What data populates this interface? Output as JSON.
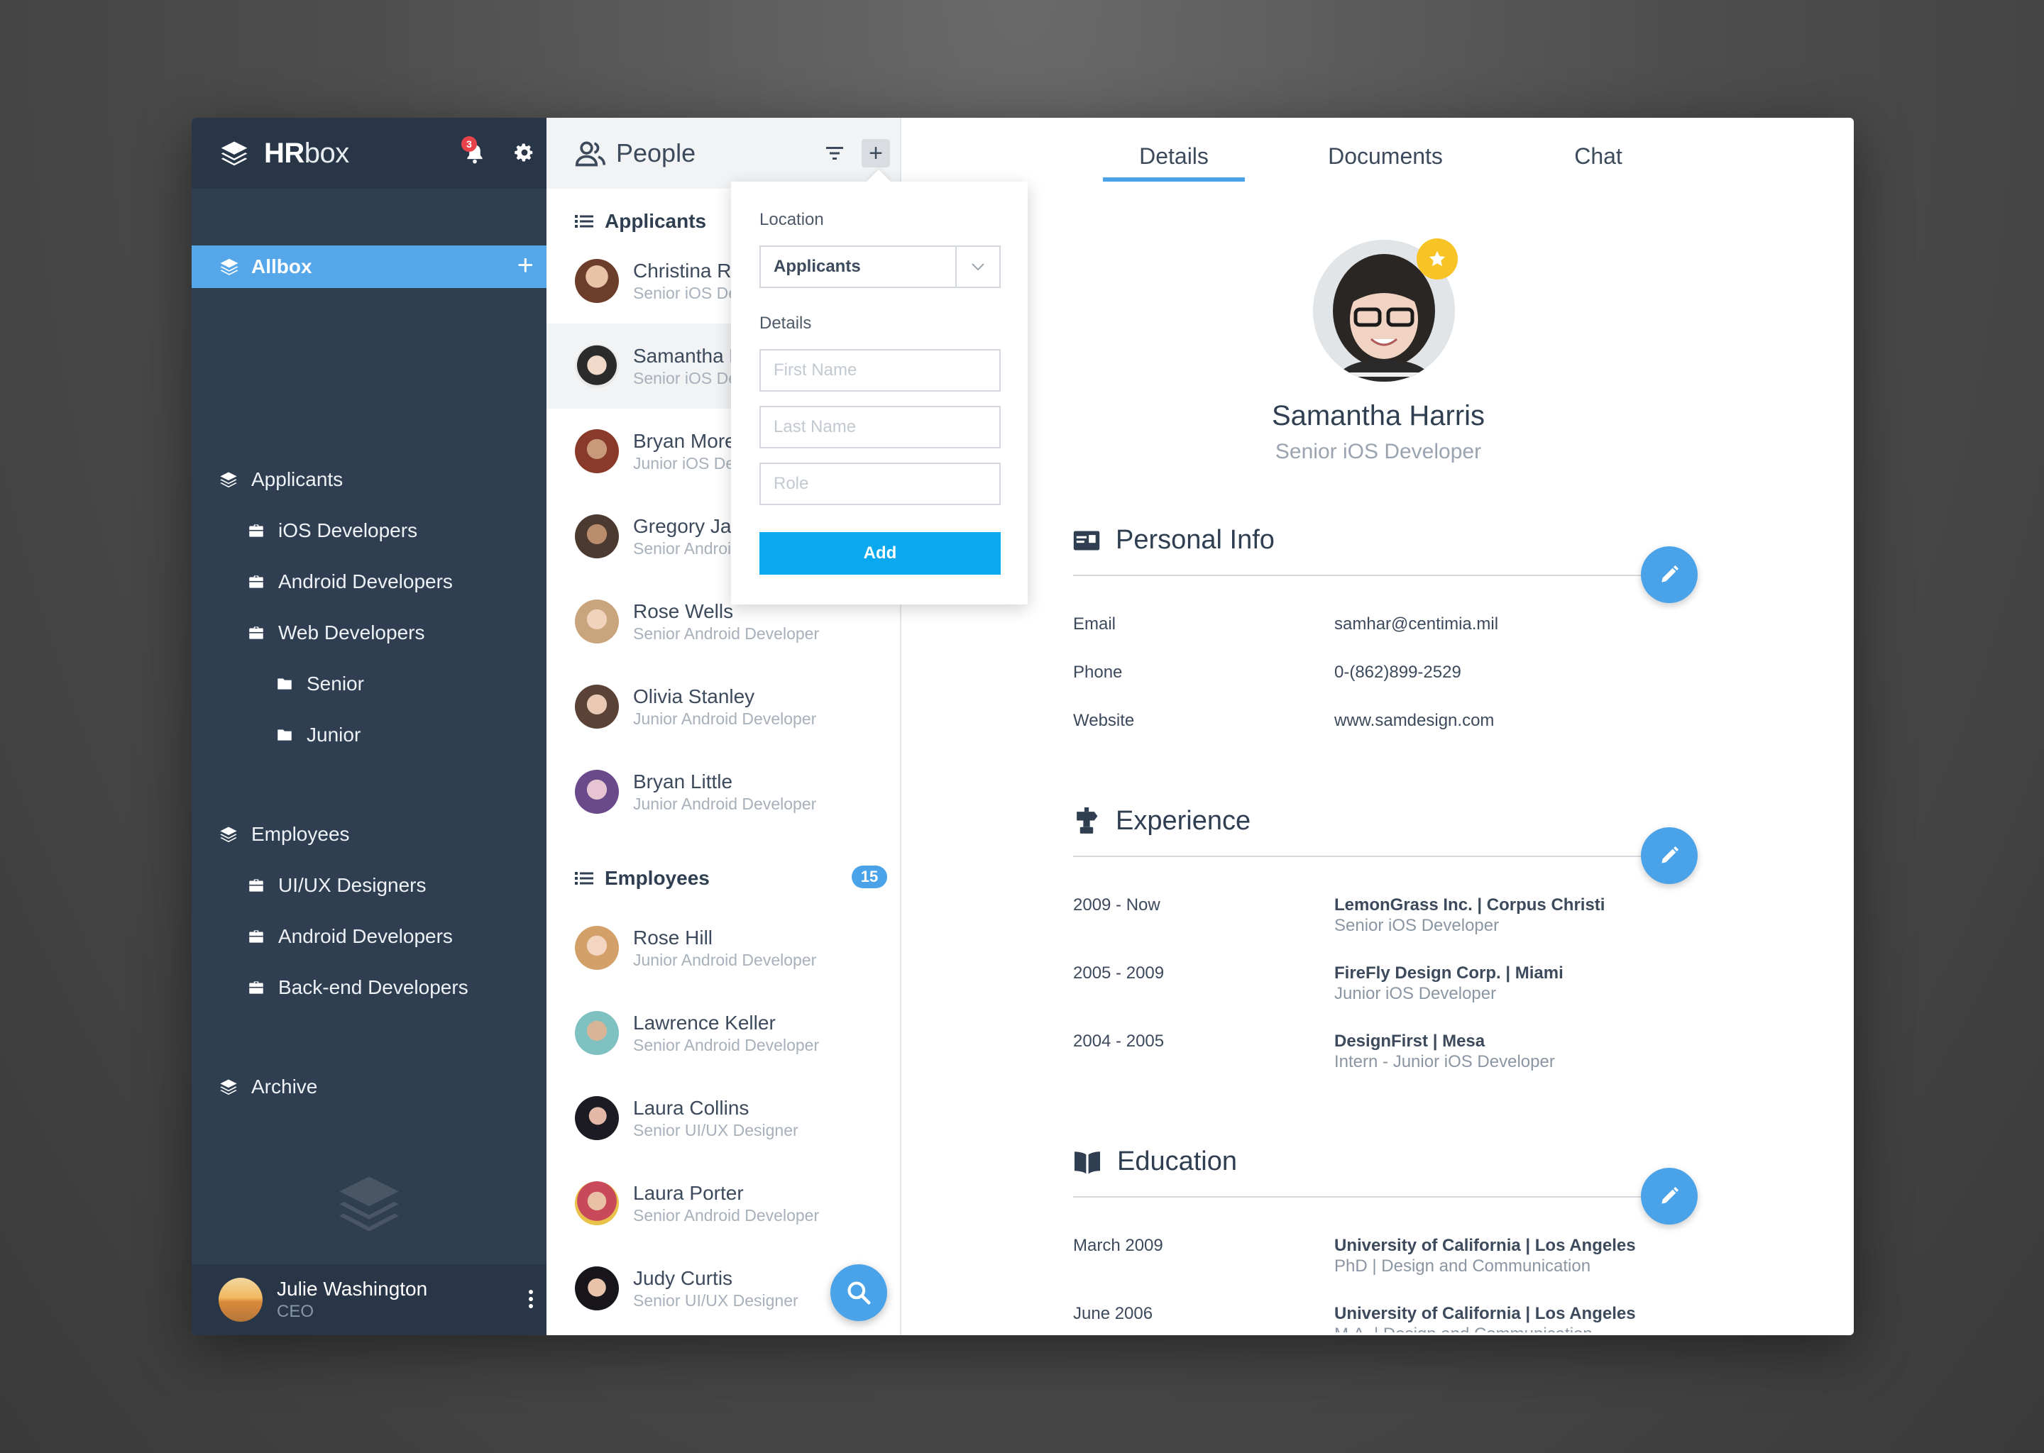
{
  "app": {
    "brand_bold": "HR",
    "brand_light": "box",
    "notification_count": "3"
  },
  "sidebar": {
    "allbox": {
      "label": "Allbox",
      "plus": "+"
    },
    "groups": [
      {
        "label": "Applicants"
      },
      {
        "label": "iOS Developers"
      },
      {
        "label": "Android Developers"
      },
      {
        "label": "Web Developers"
      },
      {
        "label": "Senior"
      },
      {
        "label": "Junior"
      },
      {
        "label": "Employees"
      },
      {
        "label": "UI/UX Designers"
      },
      {
        "label": "Android Developers"
      },
      {
        "label": "Back-end Developers"
      },
      {
        "label": "Archive"
      }
    ],
    "user": {
      "name": "Julie Washington",
      "role": "CEO"
    }
  },
  "people": {
    "title": "People",
    "add_label": "+",
    "applicants_heading": "Applicants",
    "employees_heading": "Employees",
    "employees_count": "15",
    "applicants": [
      {
        "name": "Christina Ro",
        "role": "Senior iOS Developer"
      },
      {
        "name": "Samantha Harris",
        "role": "Senior iOS Developer"
      },
      {
        "name": "Bryan Moreno",
        "role": "Junior iOS Developer"
      },
      {
        "name": "Gregory James",
        "role": "Senior Android Developer"
      },
      {
        "name": "Rose Wells",
        "role": "Senior Android Developer"
      },
      {
        "name": "Olivia Stanley",
        "role": "Junior Android Developer"
      },
      {
        "name": "Bryan Little",
        "role": "Junior Android Developer"
      }
    ],
    "employees": [
      {
        "name": "Rose Hill",
        "role": "Junior Android Developer"
      },
      {
        "name": "Lawrence Keller",
        "role": "Senior Android Developer"
      },
      {
        "name": "Laura Collins",
        "role": "Senior UI/UX Designer"
      },
      {
        "name": "Laura Porter",
        "role": "Senior Android Developer"
      },
      {
        "name": "Judy Curtis",
        "role": "Senior UI/UX Designer"
      }
    ]
  },
  "popover": {
    "location_label": "Location",
    "location_value": "Applicants",
    "details_label": "Details",
    "first_name_placeholder": "First Name",
    "last_name_placeholder": "Last Name",
    "role_placeholder": "Role",
    "add_label": "Add"
  },
  "details": {
    "tabs": [
      {
        "label": "Details",
        "active": true
      },
      {
        "label": "Documents",
        "active": false
      },
      {
        "label": "Chat",
        "active": false
      }
    ],
    "profile": {
      "name": "Samantha Harris",
      "role": "Senior iOS Developer"
    },
    "personal_info": {
      "title": "Personal Info",
      "rows": [
        {
          "key": "Email",
          "value": "samhar@centimia.mil"
        },
        {
          "key": "Phone",
          "value": "0-(862)899-2529"
        },
        {
          "key": "Website",
          "value": "www.samdesign.com"
        }
      ]
    },
    "experience": {
      "title": "Experience",
      "rows": [
        {
          "period": "2009 - Now",
          "company": "LemonGrass Inc. | Corpus Christi",
          "position": "Senior iOS Developer"
        },
        {
          "period": "2005 - 2009",
          "company": "FireFly Design Corp. | Miami",
          "position": "Junior iOS Developer"
        },
        {
          "period": "2004 - 2005",
          "company": "DesignFirst | Mesa",
          "position": "Intern - Junior iOS Developer"
        }
      ]
    },
    "education": {
      "title": "Education",
      "rows": [
        {
          "date": "March 2009",
          "school": "University of California | Los Angeles",
          "degree": "PhD | Design and Communication"
        },
        {
          "date": "June 2006",
          "school": "University of California | Los Angeles",
          "degree": "M.A. | Design and Communication"
        }
      ]
    }
  },
  "colors": {
    "sidebar_bg": "#2f3e50",
    "sidebar_header_bg": "#283647",
    "accent_blue": "#55a7ea",
    "fab_blue": "#4aa3e8",
    "add_button_blue": "#0aa8ef",
    "star_yellow": "#f7c325",
    "badge_red": "#e8434a"
  },
  "icons": {
    "logo": "layers-icon",
    "bell": "bell-icon",
    "gear": "gear-icon",
    "group": "layers-icon",
    "team": "briefcase-icon",
    "folder": "folder-icon",
    "people": "people-icon",
    "filter": "filter-icon",
    "list": "list-icon",
    "search": "search-icon",
    "edit": "pencil-icon",
    "star": "star-icon",
    "personal": "id-card-icon",
    "experience": "signpost-icon",
    "education": "book-icon",
    "more": "kebab-icon"
  }
}
